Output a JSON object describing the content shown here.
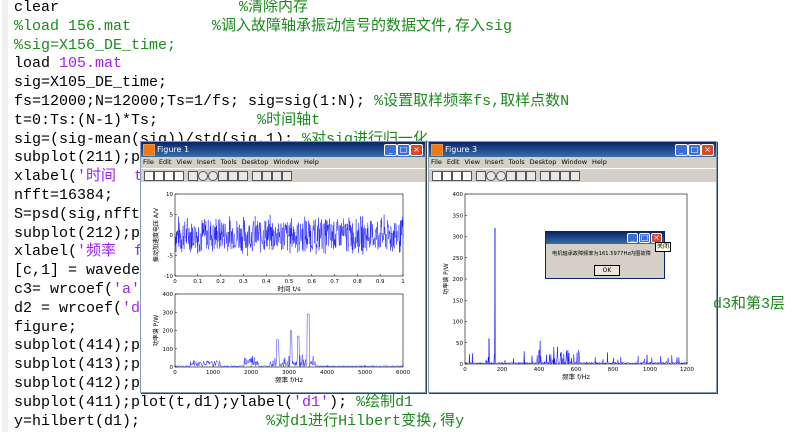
{
  "editor": {
    "lines": [
      {
        "code": "clear",
        "pad": "                    ",
        "comment": "%清除内存",
        "type": "code"
      },
      {
        "code": "",
        "pad": "",
        "comment": "%load 156.mat",
        "type": "cmtline",
        "tail": "         %调入故障轴承振动信号的数据文件,存入sig"
      },
      {
        "code": "",
        "pad": "",
        "comment": "%sig=X156_DE_time;",
        "type": "cmtonly"
      },
      {
        "code": "load ",
        "str": "105.mat",
        "type": "load"
      },
      {
        "code": "sig=X105_DE_time;",
        "type": "plain"
      },
      {
        "code": "fs=12000;N=12000;Ts=1/fs; sig=sig(1:N); ",
        "comment": "%设置取样频率fs,取样点数N",
        "type": "code2"
      },
      {
        "code": "t=0:Ts:(N-1)*Ts;",
        "pad": "           ",
        "comment": "%时间轴t",
        "type": "code"
      },
      {
        "code": "sig=(sig-mean(sig))/std(sig,1); ",
        "comment": "%对sig进行归一化",
        "type": "code2"
      },
      {
        "code": "subplot(211);p",
        "type": "plain"
      },
      {
        "code": "xlabel(",
        "str": "'时间  t",
        "type": "strline"
      },
      {
        "code": "nfft=16384;",
        "type": "plain"
      },
      {
        "code": "S=psd(sig,nfft",
        "type": "plain"
      },
      {
        "code": "subplot(212);p",
        "type": "plain"
      },
      {
        "code": "xlabel(",
        "str": "'频率  f",
        "type": "strline"
      },
      {
        "code": "[c,1] = wavede",
        "type": "plain"
      },
      {
        "code": "c3= wrcoef(",
        "str": "'a'",
        "type": "strline"
      },
      {
        "code": "d2 = wrcoef(",
        "str": "'d",
        "type": "strline"
      },
      {
        "code": "figure;",
        "type": "plain"
      },
      {
        "code": "subplot(414);p",
        "type": "plain"
      },
      {
        "code": "subplot(413);p",
        "type": "plain"
      },
      {
        "code": "subplot(412);p",
        "type": "plain"
      },
      {
        "code": "subplot(411);plot(t,d1);ylabel(",
        "str": "'d1'",
        "tail2": "); ",
        "comment": "%绘制d1",
        "type": "last1"
      },
      {
        "code": "y=hilbert(d1);",
        "pad": "              ",
        "comment": "%对d1进行Hilbert变换,得y",
        "type": "code"
      }
    ],
    "right_fragment": "d3和第3层",
    "right_fragment2": "ㄈ"
  },
  "figure1": {
    "title": "Figure 1",
    "menu": [
      "File",
      "Edit",
      "View",
      "Insert",
      "Tools",
      "Desktop",
      "Window",
      "Help"
    ],
    "top": {
      "ylabel": "振动加速度电压 A/V",
      "xlabel": "时间 t/s",
      "xticks": [
        "0",
        "0.1",
        "0.2",
        "0.3",
        "0.4",
        "0.5",
        "0.6",
        "0.7",
        "0.8",
        "0.9",
        "1"
      ],
      "yticks": [
        "10",
        "5",
        "0",
        "-5",
        "-10"
      ]
    },
    "bottom": {
      "ylabel": "功率谱 P/W",
      "xlabel": "频率 f/Hz",
      "xticks": [
        "0",
        "1000",
        "2000",
        "3000",
        "4000",
        "5000",
        "6000"
      ],
      "yticks": [
        "400",
        "300",
        "200",
        "100",
        "0"
      ]
    }
  },
  "figure3": {
    "title": "Figure 3",
    "menu": [
      "File",
      "Edit",
      "View",
      "Insert",
      "Tools",
      "Desktop",
      "Window",
      "Help"
    ],
    "ylabel": "功率谱 P/W",
    "xlabel": "频率 f/Hz",
    "xticks": [
      "0",
      "200",
      "400",
      "600",
      "800",
      "1000",
      "1200"
    ],
    "yticks": [
      "400",
      "350",
      "300",
      "250",
      "200",
      "150",
      "100",
      "50",
      "0"
    ]
  },
  "dialog": {
    "message": "电机轴承故障频率为161.5977Hz内圈故障",
    "ok_label": "OK",
    "tooltip": "关闭"
  },
  "colors": {
    "comment": "#1a8a1a",
    "string": "#a020f0",
    "trace": "#0000ff",
    "titlebar": "#0a246a"
  },
  "chart_data": [
    {
      "type": "line",
      "name": "figure1-top",
      "xlabel": "时间 t/s",
      "ylabel": "振动加速度电压 A/V",
      "xlim": [
        0,
        1
      ],
      "ylim": [
        -10,
        10
      ],
      "series": [
        {
          "values": [
            -4,
            4
          ],
          "description_range": [
            -4,
            4
          ]
        }
      ]
    },
    {
      "type": "line",
      "name": "figure1-bottom",
      "xlabel": "频率 f/Hz",
      "ylabel": "功率谱 P/W",
      "xlim": [
        0,
        6000
      ],
      "ylim": [
        0,
        400
      ]
    },
    {
      "type": "line",
      "name": "figure3",
      "xlabel": "频率 f/Hz",
      "ylabel": "功率谱 P/W",
      "xlim": [
        0,
        1200
      ],
      "ylim": [
        0,
        400
      ],
      "peaks": [
        {
          "x": 161.6,
          "y": 320
        },
        {
          "x": 130,
          "y": 60
        },
        {
          "x": 320,
          "y": 30
        },
        {
          "x": 480,
          "y": 40
        },
        {
          "x": 520,
          "y": 28
        }
      ]
    }
  ]
}
